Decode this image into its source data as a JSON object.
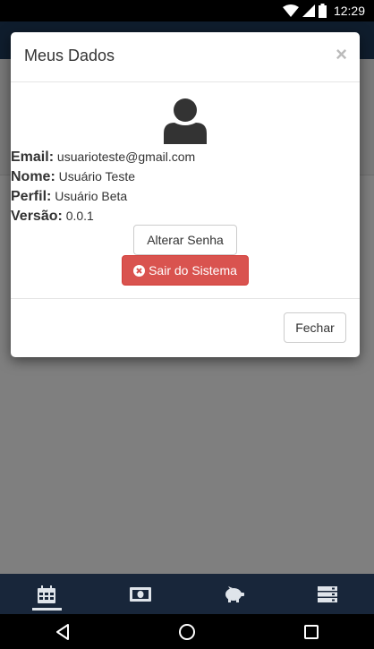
{
  "status_bar": {
    "time": "12:29",
    "icons": [
      "wifi-icon",
      "cell-signal-icon",
      "battery-icon"
    ]
  },
  "modal": {
    "title": "Meus Dados",
    "close_symbol": "×",
    "avatar_icon": "user-icon",
    "info": [
      {
        "label": "Email:",
        "value": "usuarioteste@gmail.com"
      },
      {
        "label": "Nome:",
        "value": "Usuário Teste"
      },
      {
        "label": "Perfil:",
        "value": "Usuário Beta"
      },
      {
        "label": "Versão:",
        "value": "0.0.1"
      }
    ],
    "change_password_label": "Alterar Senha",
    "logout_label": "Sair do Sistema",
    "logout_icon": "times-circle-icon",
    "footer_close_label": "Fechar"
  },
  "bottom_nav": {
    "tabs": [
      {
        "icon": "calendar-icon",
        "active": true
      },
      {
        "icon": "money-icon",
        "active": false
      },
      {
        "icon": "piggy-bank-icon",
        "active": false
      },
      {
        "icon": "server-icon",
        "active": false
      }
    ]
  },
  "android_nav": {
    "buttons": [
      "back-icon",
      "home-icon",
      "recents-icon"
    ]
  },
  "colors": {
    "danger": "#d9534f",
    "nav_background": "#18263a",
    "header_background": "#1f3b5a"
  }
}
